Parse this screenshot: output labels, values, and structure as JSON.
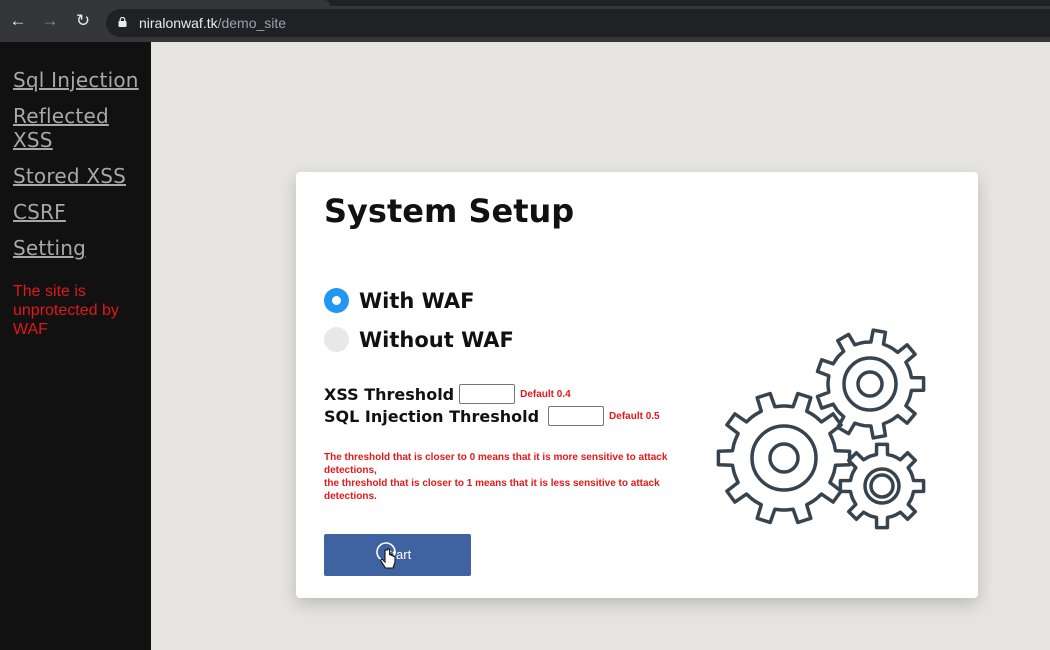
{
  "browser": {
    "url_host": "niralonwaf.tk",
    "url_path": "/demo_site",
    "icons": [
      "back-arrow-icon",
      "forward-arrow-icon",
      "reload-icon",
      "lock-icon"
    ]
  },
  "sidebar": {
    "items": [
      {
        "label": "Sql Injection"
      },
      {
        "label": "Reflected XSS"
      },
      {
        "label": "Stored XSS"
      },
      {
        "label": "CSRF"
      },
      {
        "label": "Setting"
      }
    ],
    "warning": "The site is unprotected by WAF",
    "warning_color": "#e0191b"
  },
  "setup": {
    "title": "System Setup",
    "mode_options": [
      {
        "label": "With WAF",
        "selected": true
      },
      {
        "label": "Without WAF",
        "selected": false
      }
    ],
    "thresholds": [
      {
        "label": "XSS Threshold",
        "value": "",
        "default_note": "Default 0.4"
      },
      {
        "label": "SQL Injection Threshold",
        "value": "",
        "default_note": "Default 0.5"
      }
    ],
    "note_line1": "The threshold that is closer to 0 means that it is more sensitive to attack detections,",
    "note_line2": "the threshold that is closer to 1 means that it is less sensitive to attack detections.",
    "start_label": "Start",
    "accent_color": "#2196f3",
    "button_color": "#3f62a0",
    "illustration_icon": "gears-icon"
  }
}
